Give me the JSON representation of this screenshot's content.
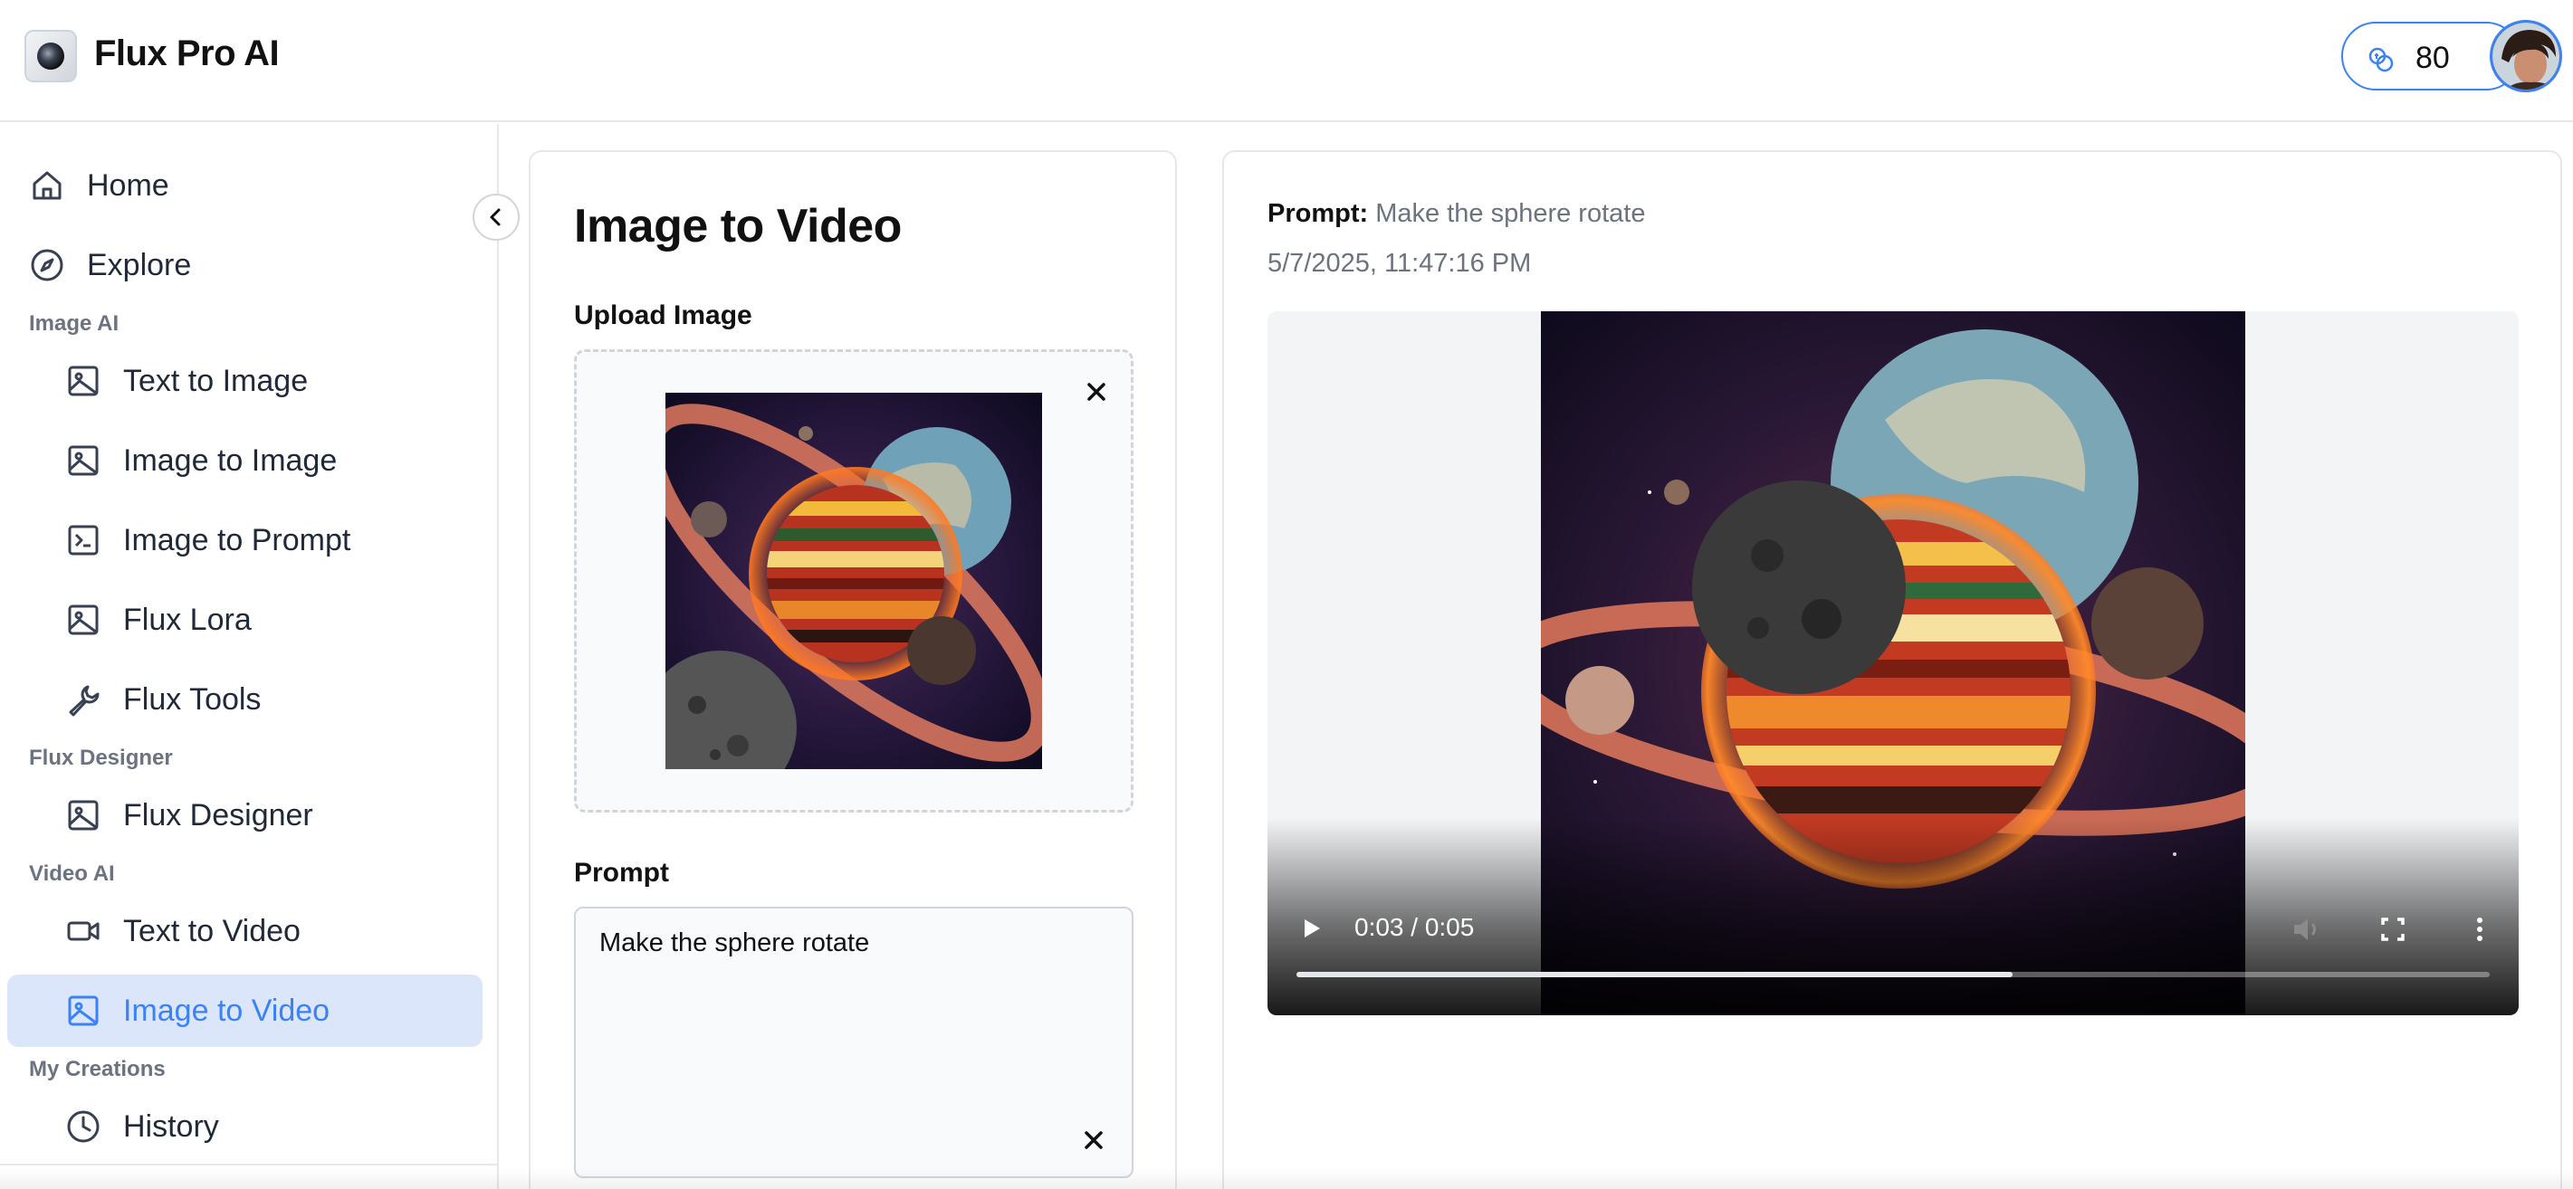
{
  "app": {
    "title": "Flux Pro AI",
    "credits": "80"
  },
  "sidebar": {
    "items": [
      {
        "label": "Home"
      },
      {
        "label": "Explore"
      }
    ],
    "sections": [
      {
        "label": "Image AI",
        "items": [
          {
            "label": "Text to Image"
          },
          {
            "label": "Image to Image"
          },
          {
            "label": "Image to Prompt"
          },
          {
            "label": "Flux Lora"
          },
          {
            "label": "Flux Tools"
          }
        ]
      },
      {
        "label": "Flux Designer",
        "items": [
          {
            "label": "Flux Designer"
          }
        ]
      },
      {
        "label": "Video AI",
        "items": [
          {
            "label": "Text to Video"
          },
          {
            "label": "Image to Video"
          }
        ]
      },
      {
        "label": "My Creations",
        "items": [
          {
            "label": "History"
          }
        ]
      }
    ]
  },
  "form": {
    "title": "Image to Video",
    "upload_label": "Upload Image",
    "prompt_label": "Prompt",
    "prompt_value": "Make the sphere rotate"
  },
  "result": {
    "prompt_label": "Prompt:",
    "prompt_text": "Make the sphere rotate",
    "timestamp": "5/7/2025, 11:47:16 PM",
    "video": {
      "time": "0:03 / 0:05",
      "progress": 0.6
    }
  },
  "colors": {
    "accent": "#3b82f6",
    "active_bg": "#dbe6fb"
  }
}
